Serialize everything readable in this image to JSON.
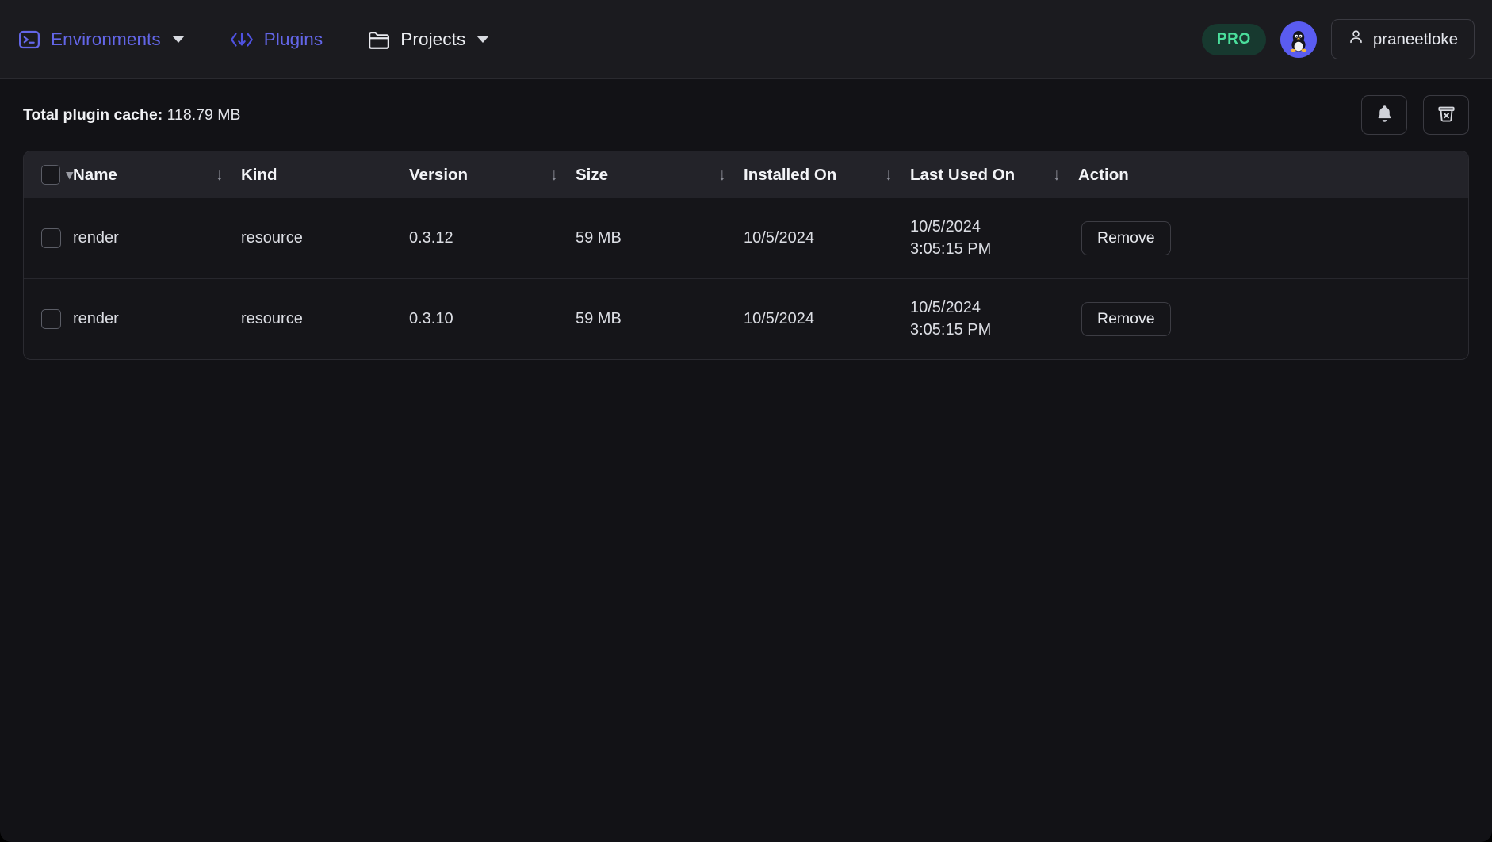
{
  "nav": {
    "items": [
      {
        "label": "Environments",
        "icon": "terminal-icon",
        "accent": true,
        "has_caret": true
      },
      {
        "label": "Plugins",
        "icon": "code-download-icon",
        "accent": true,
        "has_caret": false
      },
      {
        "label": "Projects",
        "icon": "folder-icon",
        "accent": false,
        "has_caret": true
      }
    ],
    "pro_badge": "PRO",
    "avatar_icon": "linux-penguin-avatar",
    "username": "praneetloke",
    "user_icon": "person-icon"
  },
  "subheader": {
    "cache_label": "Total plugin cache:",
    "cache_value": "118.79 MB",
    "notification_icon": "bell-icon",
    "delete_cache_icon": "trash-x-icon"
  },
  "table": {
    "select_all_checkbox": "select-all",
    "columns": [
      {
        "label": "Name",
        "sortable": true
      },
      {
        "label": "Kind",
        "sortable": false
      },
      {
        "label": "Version",
        "sortable": true
      },
      {
        "label": "Size",
        "sortable": true
      },
      {
        "label": "Installed On",
        "sortable": true
      },
      {
        "label": "Last Used On",
        "sortable": true
      },
      {
        "label": "Action",
        "sortable": false
      }
    ],
    "sort_arrow_glyph": "↓",
    "rows": [
      {
        "name": "render",
        "kind": "resource",
        "version": "0.3.12",
        "size": "59 MB",
        "installed_on": "10/5/2024",
        "last_used_date": "10/5/2024",
        "last_used_time": "3:05:15 PM",
        "action_label": "Remove"
      },
      {
        "name": "render",
        "kind": "resource",
        "version": "0.3.10",
        "size": "59 MB",
        "installed_on": "10/5/2024",
        "last_used_date": "10/5/2024",
        "last_used_time": "3:05:15 PM",
        "action_label": "Remove"
      }
    ]
  },
  "colors": {
    "accent": "#6366e8",
    "pro_text": "#4ade9b",
    "pro_bg": "#17392f",
    "avatar_bg": "#5a5cf0",
    "page_bg": "#121216",
    "topbar_bg": "#1b1b1f",
    "table_header_bg": "#232329"
  }
}
